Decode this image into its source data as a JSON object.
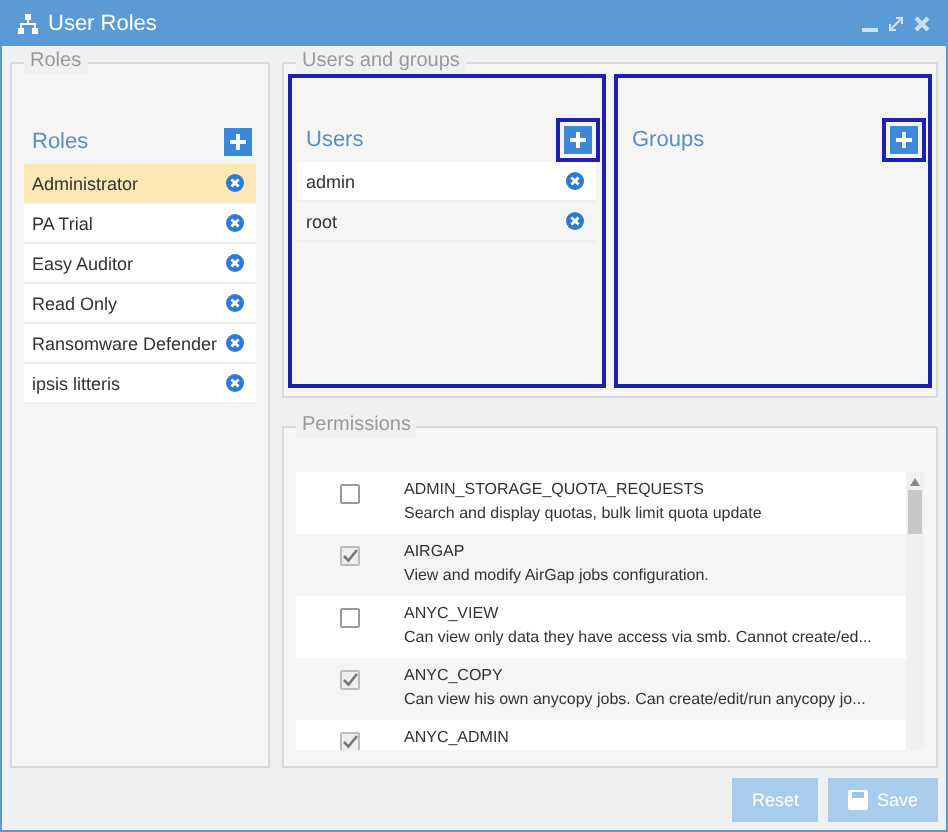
{
  "window": {
    "title": "User Roles"
  },
  "roles": {
    "legend": "Roles",
    "heading": "Roles",
    "items": [
      {
        "name": "Administrator",
        "selected": true
      },
      {
        "name": "PA Trial",
        "selected": false
      },
      {
        "name": "Easy Auditor",
        "selected": false
      },
      {
        "name": "Read Only",
        "selected": false
      },
      {
        "name": "Ransomware Defender",
        "selected": false
      },
      {
        "name": "ipsis litteris",
        "selected": false
      }
    ]
  },
  "users_and_groups": {
    "legend": "Users and groups",
    "users": {
      "heading": "Users",
      "items": [
        "admin",
        "root"
      ]
    },
    "groups": {
      "heading": "Groups"
    }
  },
  "permissions": {
    "legend": "Permissions",
    "rows": [
      {
        "name": "ADMIN_STORAGE_QUOTA_REQUESTS",
        "description": "Search and display quotas, bulk limit quota update",
        "checked": false
      },
      {
        "name": "AIRGAP",
        "description": "View and modify AirGap jobs configuration.",
        "checked": true
      },
      {
        "name": "ANYC_VIEW",
        "description": "Can view only data they have access via smb. Cannot create/ed...",
        "checked": false
      },
      {
        "name": "ANYC_COPY",
        "description": "Can view his own anycopy jobs. Can create/edit/run anycopy jo...",
        "checked": true
      },
      {
        "name": "ANYC_ADMIN",
        "checked": true
      }
    ]
  },
  "buttons": [
    {
      "label": "Reset",
      "kind": "reset",
      "disabled": true
    },
    {
      "label": "Save",
      "kind": "save",
      "disabled": true
    }
  ]
}
